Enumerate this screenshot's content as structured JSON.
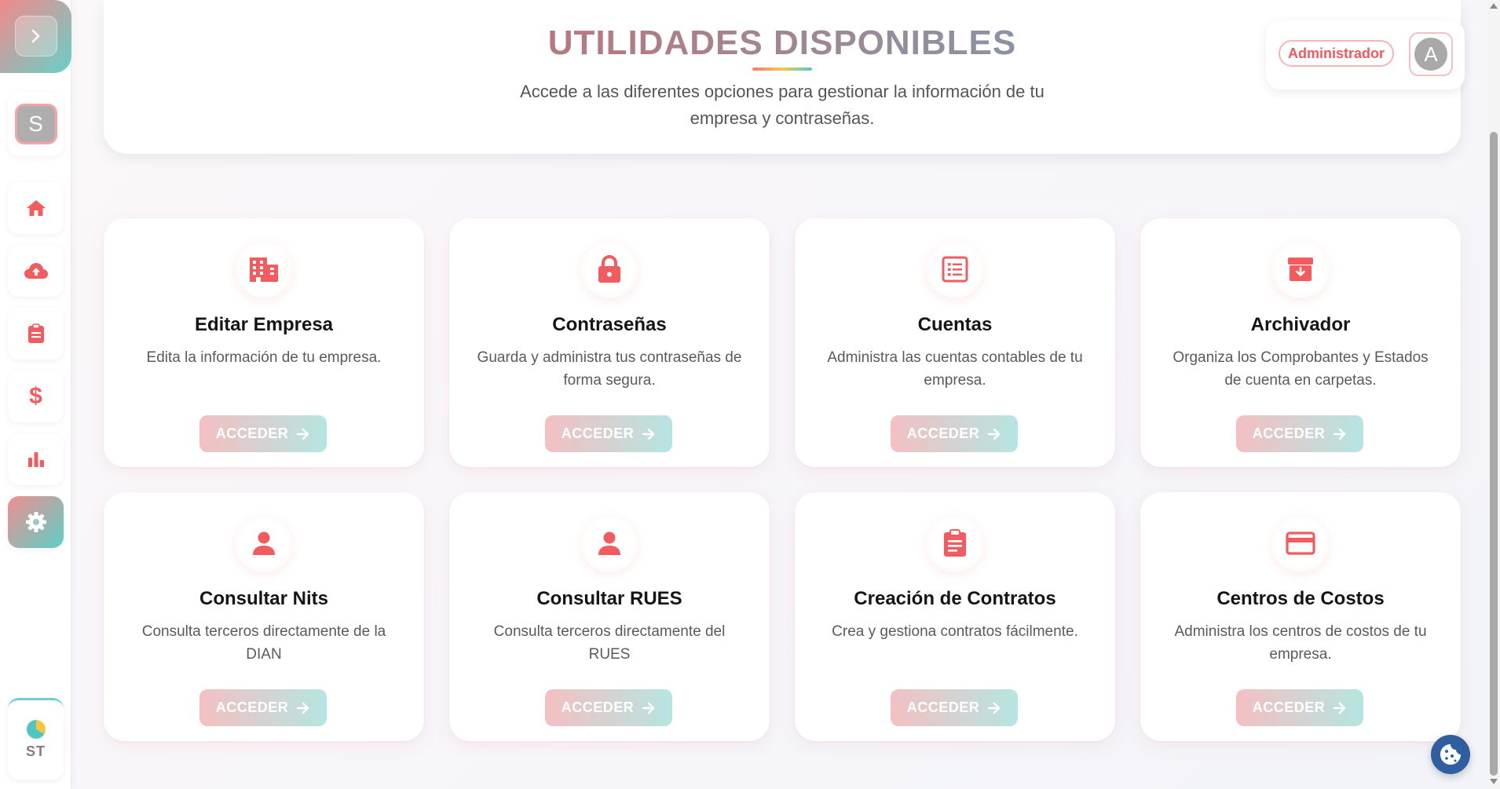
{
  "sidebar": {
    "toggle_icon": "chevron-right-icon",
    "profile_initial": "S",
    "items": [
      {
        "name": "home",
        "icon": "home-icon"
      },
      {
        "name": "upload",
        "icon": "cloud-upload-icon"
      },
      {
        "name": "reports",
        "icon": "clipboard-icon"
      },
      {
        "name": "finance",
        "icon": "dollar-icon"
      },
      {
        "name": "stats",
        "icon": "bar-chart-icon"
      },
      {
        "name": "settings",
        "icon": "gear-icon",
        "active": true
      }
    ],
    "footer_initials": "ST"
  },
  "header": {
    "title": "UTILIDADES DISPONIBLES",
    "subtitle": "Accede a las diferentes opciones para gestionar la información de tu empresa y contraseñas."
  },
  "user": {
    "role": "Administrador",
    "avatar_initial": "A"
  },
  "cards": [
    {
      "title": "Editar Empresa",
      "description": "Edita la información de tu empresa.",
      "button": "ACCEDER",
      "icon": "building-icon"
    },
    {
      "title": "Contraseñas",
      "description": "Guarda y administra tus contraseñas de forma segura.",
      "button": "ACCEDER",
      "icon": "lock-icon"
    },
    {
      "title": "Cuentas",
      "description": "Administra las cuentas contables de tu empresa.",
      "button": "ACCEDER",
      "icon": "list-icon"
    },
    {
      "title": "Archivador",
      "description": "Organiza los Comprobantes y Estados de cuenta en carpetas.",
      "button": "ACCEDER",
      "icon": "archive-icon"
    },
    {
      "title": "Consultar Nits",
      "description": "Consulta terceros directamente de la DIAN",
      "button": "ACCEDER",
      "icon": "user-icon"
    },
    {
      "title": "Consultar RUES",
      "description": "Consulta terceros directamente del RUES",
      "button": "ACCEDER",
      "icon": "user-icon"
    },
    {
      "title": "Creación de Contratos",
      "description": "Crea y gestiona contratos fácilmente.",
      "button": "ACCEDER",
      "icon": "clipboard-list-icon"
    },
    {
      "title": "Centros de Costos",
      "description": "Administra los centros de costos de tu empresa.",
      "button": "ACCEDER",
      "icon": "credit-card-icon"
    }
  ],
  "colors": {
    "accent_red": "#f25c5e",
    "accent_teal": "#5ccfc4",
    "cookie_button": "#2f5f9e"
  },
  "floating": {
    "icon": "cookie-icon"
  }
}
